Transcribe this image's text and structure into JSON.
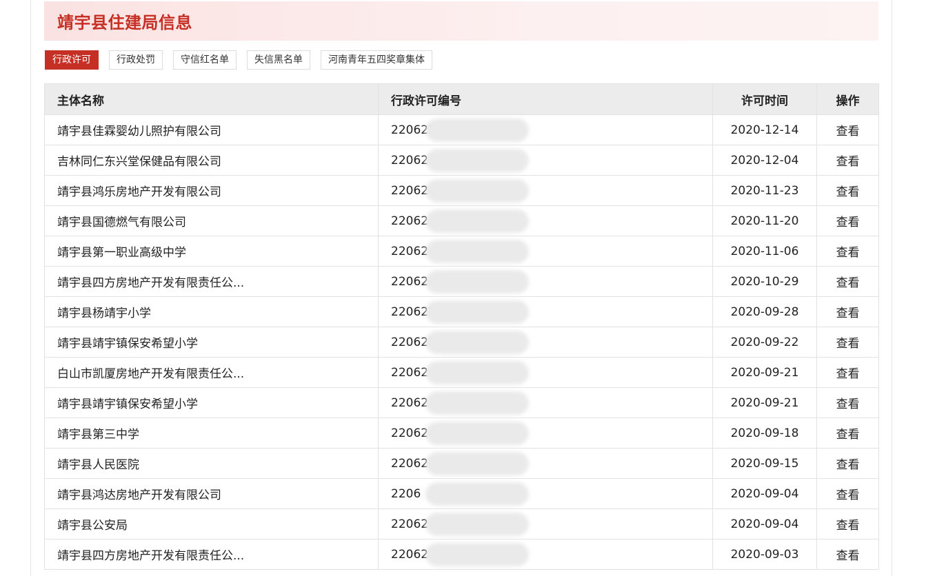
{
  "header": {
    "title": "靖宇县住建局信息"
  },
  "tabs": [
    {
      "label": "行政许可",
      "active": true
    },
    {
      "label": "行政处罚",
      "active": false
    },
    {
      "label": "守信红名单",
      "active": false
    },
    {
      "label": "失信黑名单",
      "active": false
    },
    {
      "label": "河南青年五四奖章集体",
      "active": false
    }
  ],
  "colors": {
    "accent": "#c62f24",
    "title_bar_bg": "#fbe2e2",
    "header_row_bg": "#ececec"
  },
  "table": {
    "columns": {
      "name": "主体名称",
      "no": "行政许可编号",
      "time": "许可时间",
      "op": "操作"
    },
    "rows": [
      {
        "name": "靖宇县佳霖婴幼儿照护有限公司",
        "no": "220622",
        "time": "2020-12-14",
        "op": "查看"
      },
      {
        "name": "吉林同仁东兴堂保健品有限公司",
        "no": "22062",
        "time": "2020-12-04",
        "op": "查看"
      },
      {
        "name": "靖宇县鸿乐房地产开发有限公司",
        "no": "22062",
        "time": "2020-11-23",
        "op": "查看"
      },
      {
        "name": "靖宇县国德燃气有限公司",
        "no": "22062",
        "time": "2020-11-20",
        "op": "查看"
      },
      {
        "name": "靖宇县第一职业高级中学",
        "no": "22062",
        "time": "2020-11-06",
        "op": "查看"
      },
      {
        "name": "靖宇县四方房地产开发有限责任公...",
        "no": "22062",
        "time": "2020-10-29",
        "op": "查看"
      },
      {
        "name": "靖宇县杨靖宇小学",
        "no": "220622",
        "time": "2020-09-28",
        "op": "查看"
      },
      {
        "name": "靖宇县靖宇镇保安希望小学",
        "no": "220622",
        "time": "2020-09-22",
        "op": "查看"
      },
      {
        "name": "白山市凯厦房地产开发有限责任公...",
        "no": "22062",
        "time": "2020-09-21",
        "op": "查看"
      },
      {
        "name": "靖宇县靖宇镇保安希望小学",
        "no": "22062",
        "time": "2020-09-21",
        "op": "查看"
      },
      {
        "name": "靖宇县第三中学",
        "no": "22062",
        "time": "2020-09-18",
        "op": "查看"
      },
      {
        "name": "靖宇县人民医院",
        "no": "22062",
        "time": "2020-09-15",
        "op": "查看"
      },
      {
        "name": "靖宇县鸿达房地产开发有限公司",
        "no": "2206",
        "time": "2020-09-04",
        "op": "查看"
      },
      {
        "name": "靖宇县公安局",
        "no": "22062",
        "time": "2020-09-04",
        "op": "查看"
      },
      {
        "name": "靖宇县四方房地产开发有限责任公...",
        "no": "22062",
        "time": "2020-09-03",
        "op": "查看"
      }
    ]
  }
}
